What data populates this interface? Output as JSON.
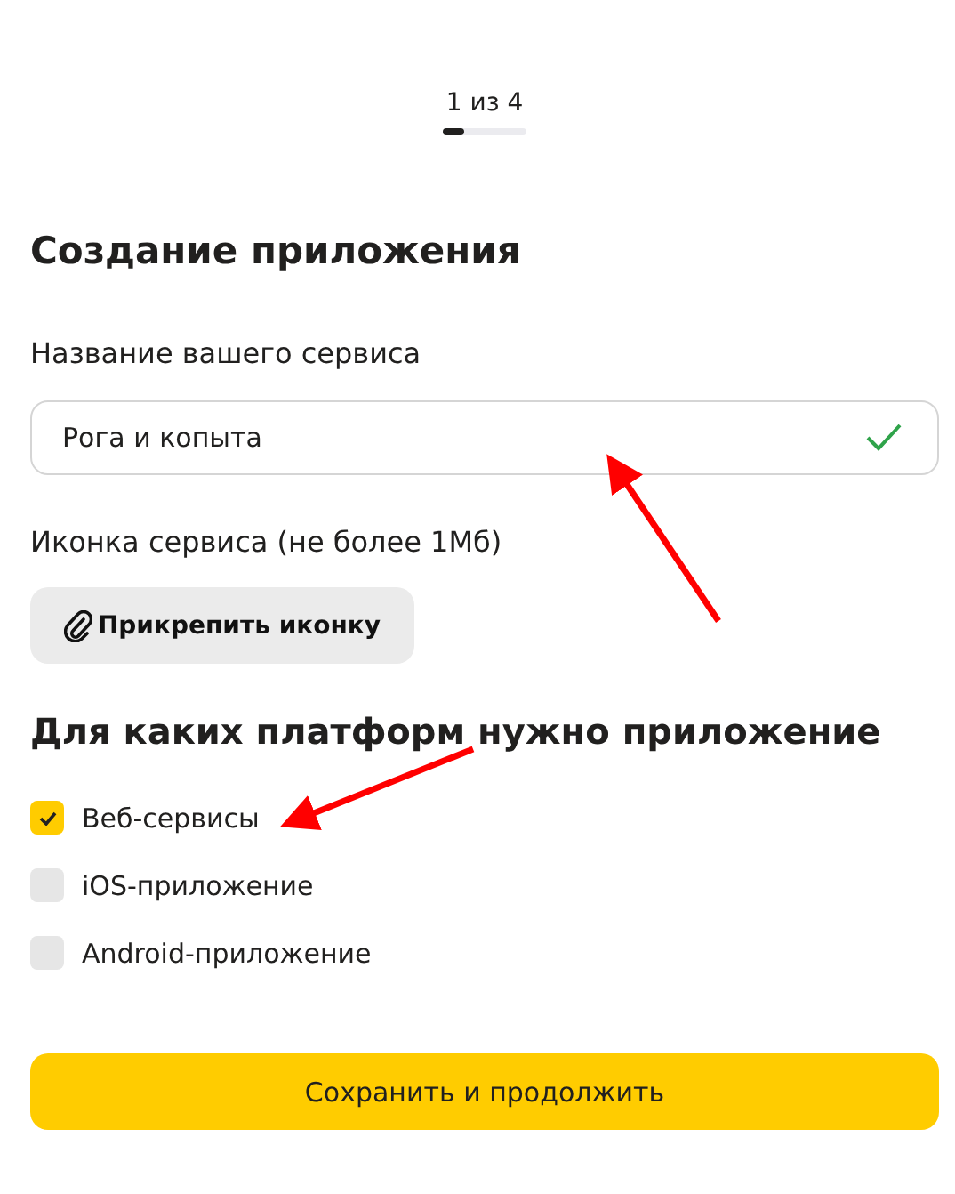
{
  "stepper": {
    "text": "1 из 4",
    "level": 0.25
  },
  "title": "Создание приложения",
  "name_field": {
    "label": "Название вашего сервиса",
    "value": "Рога и копыта",
    "valid": true
  },
  "icon_upload": {
    "label": "Иконка сервиса (не более 1Мб)",
    "button": "Прикрепить иконку"
  },
  "platforms": {
    "title": "Для каких платформ нужно приложение",
    "items": [
      {
        "label": "Веб-сервисы",
        "checked": true
      },
      {
        "label": "iOS-приложение",
        "checked": false
      },
      {
        "label": "Android-приложение",
        "checked": false
      }
    ]
  },
  "submit": "Сохранить и продолжить"
}
